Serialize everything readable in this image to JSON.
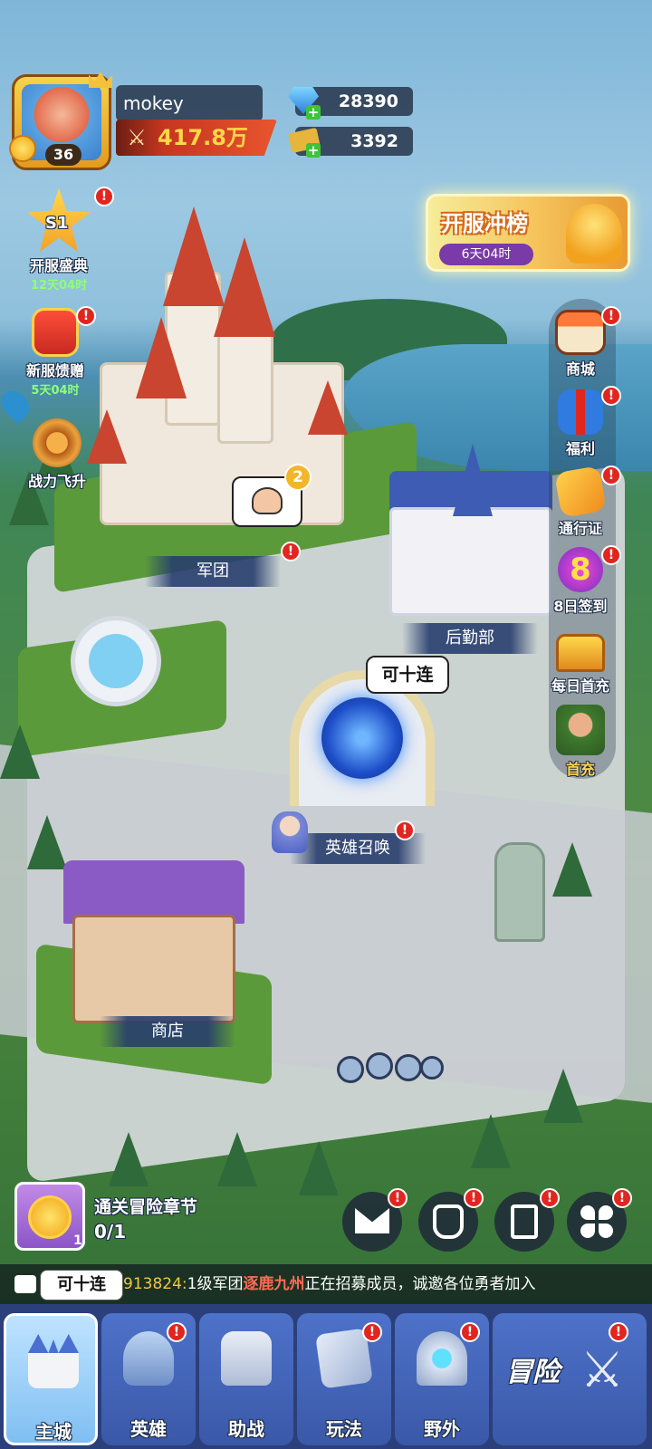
{
  "player": {
    "name": "mokey",
    "level": "36",
    "power": "417.8万"
  },
  "resources": {
    "gems": "28390",
    "tickets": "3392"
  },
  "left_menu": [
    {
      "label": "开服盛典",
      "timer": "12天04时",
      "badge": "S1"
    },
    {
      "label": "新服馈赠",
      "timer": "5天04时"
    },
    {
      "label": "战力飞升",
      "timer": ""
    }
  ],
  "event_banner": {
    "title": "开服冲榜",
    "timer": "6天04时"
  },
  "right_menu": [
    {
      "label": "商城"
    },
    {
      "label": "福利"
    },
    {
      "label": "通行证"
    },
    {
      "label": "8日签到",
      "badge": "8"
    },
    {
      "label": "每日首充"
    },
    {
      "label": "首充"
    }
  ],
  "buildings": {
    "guild": "军团",
    "guild_count": "2",
    "logistics": "后勤部",
    "summon": "英雄召唤",
    "summon_bubble": "可十连",
    "shop": "商店"
  },
  "quest": {
    "title": "通关冒险章节",
    "progress": "0/1",
    "count": "1"
  },
  "ticker": {
    "tip": "可十连",
    "id": "913824:",
    "before": "1级军团",
    "guild": "逐鹿九州",
    "after": "正在招募成员，诚邀各位勇者加入"
  },
  "tabs": [
    {
      "label": "主城"
    },
    {
      "label": "英雄"
    },
    {
      "label": "助战"
    },
    {
      "label": "玩法"
    },
    {
      "label": "野外"
    }
  ],
  "adventure_label": "冒险",
  "colors": {
    "badge_red": "#e0261f",
    "tab_bar": "#2b3f7a",
    "power_gold": "#ffd64a"
  },
  "icons": [
    "mail-icon",
    "armor-icon",
    "checklist-icon",
    "clover-icon",
    "location-pin-icon",
    "swords-icon",
    "gem-icon",
    "ticket-icon"
  ]
}
